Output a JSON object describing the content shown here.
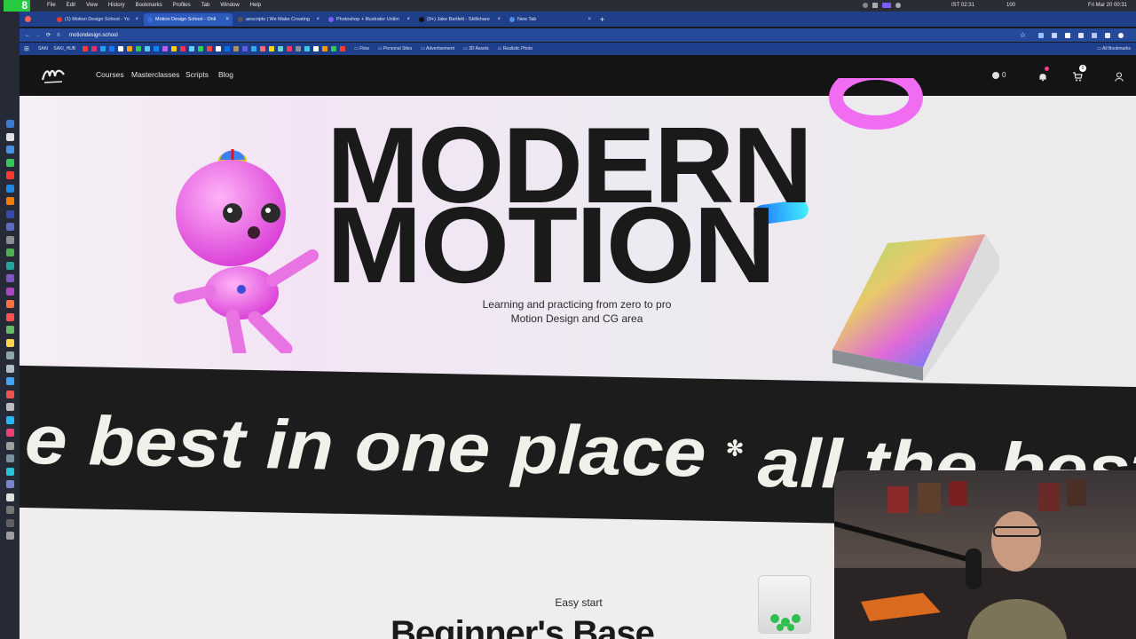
{
  "menubar": {
    "badge": "8",
    "items": [
      "File",
      "Edit",
      "View",
      "History",
      "Bookmarks",
      "Profiles",
      "Tab",
      "Window",
      "Help"
    ],
    "status": [
      "IST 02:31",
      "100"
    ],
    "clock": "Fri Mar 20  00:31"
  },
  "tabs": [
    {
      "label": "(1) Motion Design School - Yo",
      "color": "#e53935",
      "active": false
    },
    {
      "label": "Motion Design School - Onli",
      "color": "#3b6ee0",
      "active": true
    },
    {
      "label": "aescripts | We Make Creating",
      "color": "#555555",
      "active": false
    },
    {
      "label": "Photoshop + Illustrator Unlim",
      "color": "#7a5cff",
      "active": false
    },
    {
      "label": "(9+) Jake Bartlett - Skillshare",
      "color": "#111111",
      "active": false
    },
    {
      "label": "New Tab",
      "color": "#4a90e2",
      "active": false
    }
  ],
  "address": {
    "url": "motiondesign.school"
  },
  "bookmarks": {
    "left_labels": [
      "SAKI",
      "SAKI_HUB"
    ],
    "folders": [
      "Flow",
      "Personal Sites",
      "Advertisement",
      "3D Assets",
      "Realistic Photo"
    ],
    "all": "All Bookmarks"
  },
  "nav": {
    "logo": "Motion Design School",
    "links": [
      "Courses",
      "Masterclasses",
      "Scripts",
      "Blog"
    ],
    "coins": "0",
    "cart_count": "0"
  },
  "hero": {
    "line1": "MODERN",
    "line2": "MOTION",
    "subtitle1": "Learning and practicing from zero to pro",
    "subtitle2": "Motion Design and CG area"
  },
  "band": {
    "text1": "e best in one place",
    "separator": "✻",
    "text2": "all the best"
  },
  "section": {
    "eyebrow": "Easy start",
    "title": "Beginner's Base"
  },
  "colors": {
    "tabbar": "#1f3f8a",
    "nav": "#141414",
    "band": "#1c1c1c",
    "page": "#efeeec",
    "pink": "#ee6ee8"
  }
}
